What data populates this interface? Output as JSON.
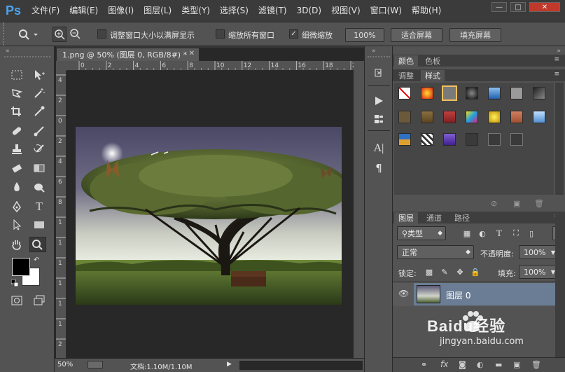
{
  "app": {
    "logo": "Ps"
  },
  "menu": {
    "items": [
      "文件(F)",
      "编辑(E)",
      "图像(I)",
      "图层(L)",
      "类型(Y)",
      "选择(S)",
      "滤镜(T)",
      "3D(D)",
      "视图(V)",
      "窗口(W)",
      "帮助(H)"
    ]
  },
  "window_controls": {
    "minimize": "—",
    "restore": "□",
    "close": "✕"
  },
  "options": {
    "resize_windows_label": "调整窗口大小以满屏显示",
    "zoom_all_label": "缩放所有窗口",
    "scrubby_zoom_label": "细微缩放",
    "scrubby_checked": "✓",
    "zoom_100": "100%",
    "fit_screen": "适合屏幕",
    "fill_screen": "填充屏幕"
  },
  "document": {
    "tab_title": "1.png @ 50% (图层 0, RGB/8#) *",
    "close": "✕",
    "ruler_h": [
      "0",
      "2",
      "4",
      "6",
      "8",
      "10",
      "12",
      "14",
      "16",
      "18",
      "20"
    ],
    "ruler_v": [
      "4",
      "2",
      "0",
      "2",
      "4",
      "6",
      "8",
      "1",
      "1",
      "1",
      "1",
      "1",
      "1",
      "2"
    ]
  },
  "status": {
    "zoom": "50%",
    "doc_info": "文档:1.10M/1.10M",
    "arrow": "▶"
  },
  "panels": {
    "color_tabs": [
      "颜色",
      "色板"
    ],
    "adjust_tabs": [
      "调整",
      "样式"
    ],
    "layer_tabs": [
      "图层",
      "通道",
      "路径"
    ],
    "filter_kind": "类型",
    "blend_mode": "正常",
    "opacity_label": "不透明度:",
    "opacity_value": "100%",
    "lock_label": "锁定:",
    "fill_label": "填充:",
    "fill_value": "100%",
    "layers": [
      {
        "name": "图层 0"
      }
    ]
  },
  "watermark": {
    "brand": "Baidu经验",
    "url": "jingyan.baidu.com"
  }
}
